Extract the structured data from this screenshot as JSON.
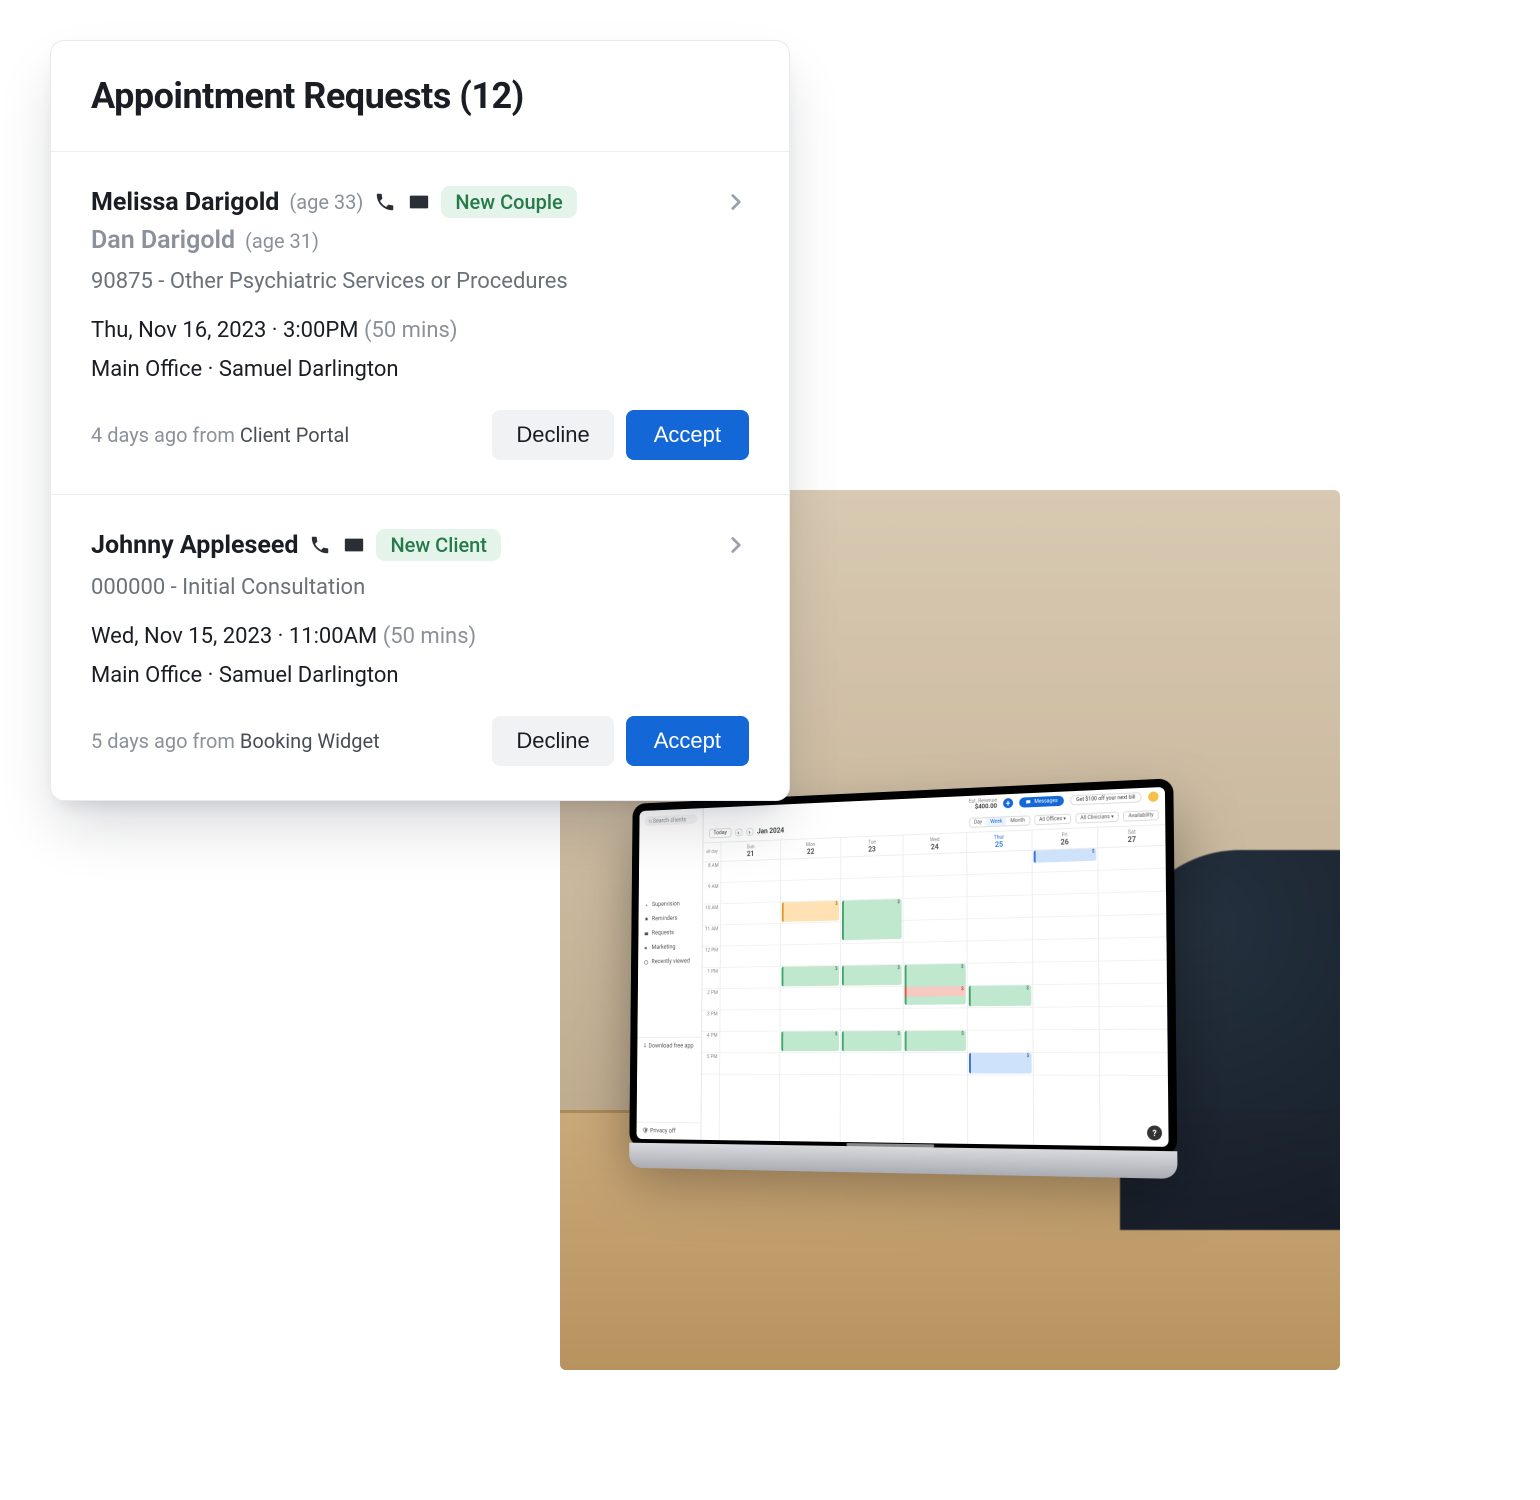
{
  "card": {
    "title": "Appointment Requests (12)"
  },
  "requests": [
    {
      "primary_name": "Melissa Darigold",
      "primary_age": "(age 33)",
      "secondary_name": "Dan Darigold",
      "secondary_age": "(age 31)",
      "badge": "New Couple",
      "service": "90875 - Other Psychiatric Services or Procedures",
      "datetime": "Thu, Nov 16, 2023 · 3:00PM",
      "duration": "(50 mins)",
      "location": "Main Office · Samuel Darlington",
      "meta_prefix": "4 days ago from ",
      "meta_source": "Client Portal",
      "decline": "Decline",
      "accept": "Accept"
    },
    {
      "primary_name": "Johnny Appleseed",
      "primary_age": "",
      "secondary_name": "",
      "secondary_age": "",
      "badge": "New Client",
      "service": "000000 - Initial Consultation",
      "datetime": "Wed, Nov 15, 2023 · 11:00AM",
      "duration": "(50 mins)",
      "location": "Main Office · Samuel Darlington",
      "meta_prefix": "5 days ago from ",
      "meta_source": "Booking Widget",
      "decline": "Decline",
      "accept": "Accept"
    }
  ],
  "laptop": {
    "search_placeholder": "Search clients",
    "revenue_label": "Est. Revenue",
    "revenue_value": "$400.00",
    "messages": "Messages",
    "promo": "Get $100 off your next bill",
    "today": "Today",
    "period": "Jan 2024",
    "views": {
      "day": "Day",
      "week": "Week",
      "month": "Month"
    },
    "filters": {
      "offices": "All Offices",
      "clinicians": "All Clinicians",
      "availability": "Availability"
    },
    "nav": {
      "supervision": "Supervision",
      "reminders": "Reminders",
      "requests": "Requests",
      "marketing": "Marketing",
      "recently_viewed": "Recently viewed",
      "download": "Download free app",
      "privacy": "Privacy off"
    },
    "time_header": "all day",
    "hours": [
      "8 AM",
      "9 AM",
      "10 AM",
      "11 AM",
      "12 PM",
      "1 PM",
      "2 PM",
      "3 PM",
      "4 PM",
      "5 PM"
    ],
    "days": [
      {
        "dow": "Sun",
        "num": "21"
      },
      {
        "dow": "Mon",
        "num": "22"
      },
      {
        "dow": "Tue",
        "num": "23"
      },
      {
        "dow": "Wed",
        "num": "24"
      },
      {
        "dow": "Thur",
        "num": "25",
        "highlight": true
      },
      {
        "dow": "Fri",
        "num": "26"
      },
      {
        "dow": "Sat",
        "num": "27"
      }
    ],
    "help": "?"
  }
}
